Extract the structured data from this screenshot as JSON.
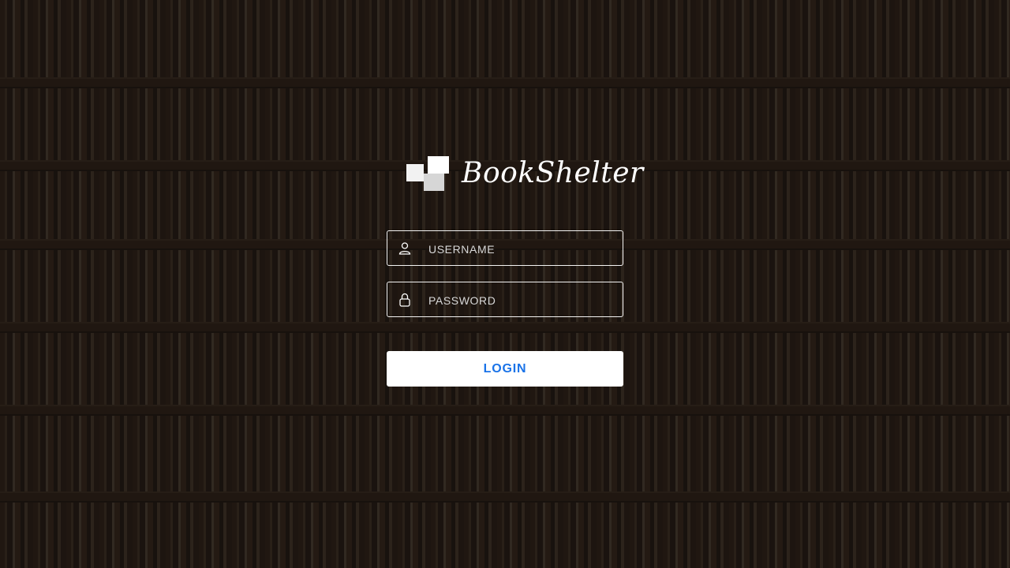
{
  "app": {
    "title": "BookShelter"
  },
  "login_form": {
    "username": {
      "placeholder": "USERNAME",
      "value": "",
      "icon": "user-icon"
    },
    "password": {
      "placeholder": "PASSWORD",
      "value": "",
      "icon": "lock-icon"
    },
    "submit_label": "LOGIN"
  },
  "colors": {
    "button_text": "#1a73e8",
    "button_background": "#ffffff",
    "field_border": "#ffffff"
  },
  "background": {
    "description_icon": "bookshelf-background"
  }
}
